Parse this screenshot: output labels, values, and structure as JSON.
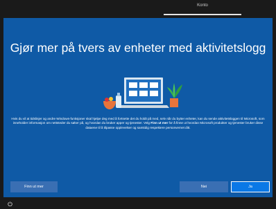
{
  "topbar": {
    "tab_label": "Konto"
  },
  "main": {
    "title": "Gjør mer på tvers av enheter med aktivitetslogg",
    "paragraph1": "Hvis du vil at tidslinjer og andre Windows-funksjoner skal hjelpe deg med å fortsette det du holdt på med, selv når du bytter enheter, kan du sende aktivitetsloggen til Microsoft, som inneholder informasjon om nettsteder du søker på, og hvordan du bruker apper og tjenester.",
    "paragraph2_prefix": "Velg ",
    "paragraph2_bold": "Finn ut mer",
    "paragraph2_suffix": " for å finne ut hvordan Microsoft produkter og tjenester bruker disse dataene til å tilpasse opplevelser og samtidig respektere personvernet ditt."
  },
  "buttons": {
    "learn_more": "Finn ut mer",
    "no": "Nei",
    "yes": "Ja"
  },
  "icons": {
    "power": "power-icon",
    "illustration": "devices-illustration"
  },
  "colors": {
    "background": "#0f5aa6",
    "accent": "#0a78e6"
  }
}
